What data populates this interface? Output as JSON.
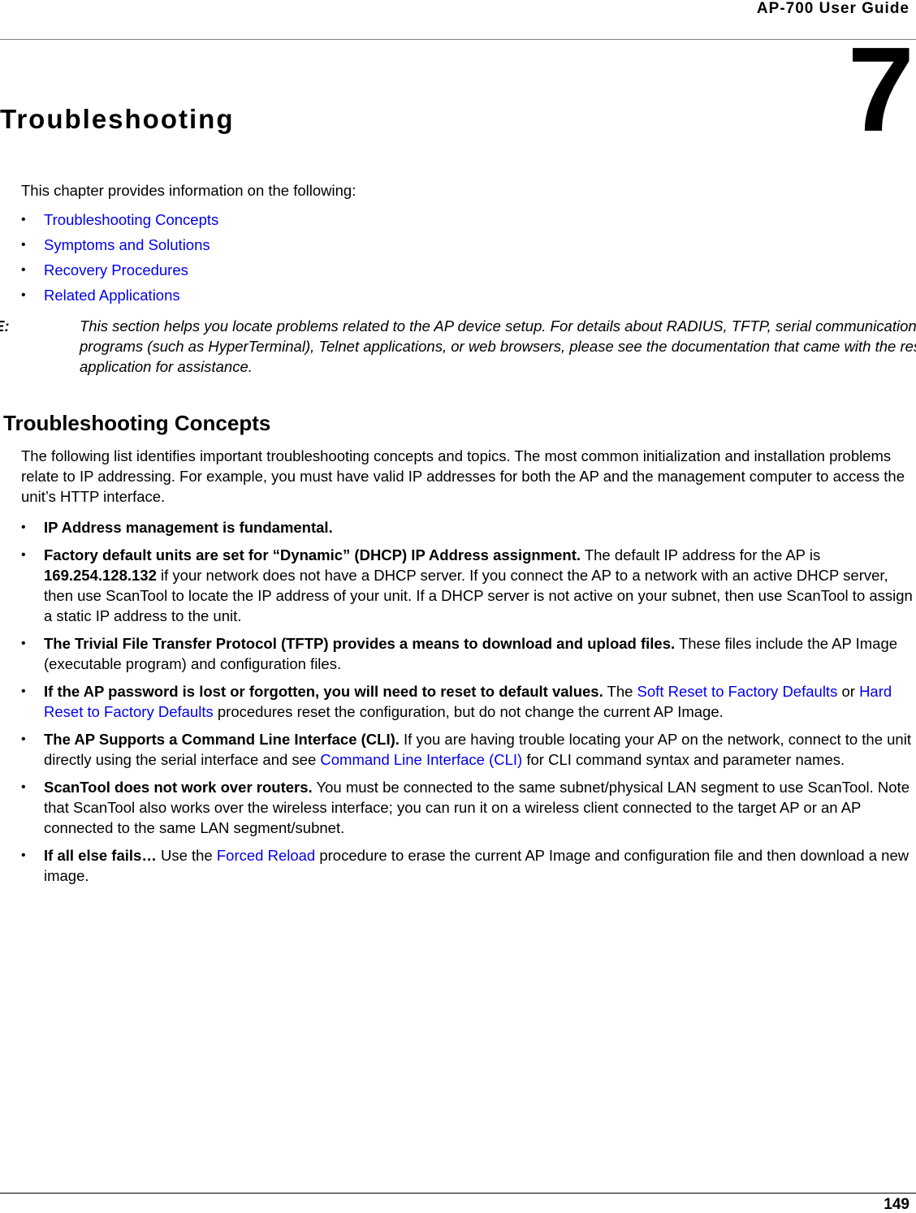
{
  "header": {
    "running_title": "AP-700 User Guide"
  },
  "chapter": {
    "number": "7",
    "title": "Troubleshooting"
  },
  "intro": {
    "text": "This chapter provides information on the following:",
    "links": [
      {
        "label": "Troubleshooting Concepts"
      },
      {
        "label": "Symptoms and Solutions"
      },
      {
        "label": "Recovery Procedures"
      },
      {
        "label": "Related Applications"
      }
    ],
    "bullet": "•"
  },
  "note": {
    "label": "NOTE:",
    "text": "This section helps you locate problems related to the AP device setup. For details about RADIUS, TFTP, serial communication programs (such as HyperTerminal), Telnet applications, or web browsers, please see the documentation that came with the respective application for assistance."
  },
  "section": {
    "heading": "Troubleshooting Concepts",
    "intro": "The following list identifies important troubleshooting concepts and topics. The most common initialization and installation problems relate to IP addressing. For example, you must have valid IP addresses for both the AP and the management computer to access the unit’s HTTP interface.",
    "items": [
      {
        "bold": "IP Address management is fundamental."
      },
      {
        "bold": "Factory default units are set for “Dynamic” (DHCP) IP Address assignment.",
        "text1": " The default IP address for the AP is ",
        "bold2": "169.254.128.132",
        "text2": " if your network does not have a DHCP server. If you connect the AP to a network with an active DHCP server, then use ScanTool to locate the IP address of your unit. If a DHCP server is not active on your subnet, then use ScanTool to assign a static IP address to the unit."
      },
      {
        "bold": "The Trivial File Transfer Protocol (TFTP) provides a means to download and upload files.",
        "text1": " These files include the AP Image (executable program) and configuration files."
      },
      {
        "bold": "If the AP password is lost or forgotten, you will need to reset to default values.",
        "text1": " The ",
        "link1": "Soft Reset to Factory Defaults",
        "text2": " or ",
        "link2": "Hard Reset to Factory Defaults",
        "text3": " procedures reset the configuration, but do not change the current AP Image."
      },
      {
        "bold": "The AP Supports a Command Line Interface (CLI).",
        "text1": " If you are having trouble locating your AP on the network, connect to the unit directly using the serial interface and see ",
        "link1": "Command Line Interface (CLI)",
        "text2": " for CLI command syntax and parameter names."
      },
      {
        "bold": "ScanTool does not work over routers.",
        "text1": " You must be connected to the same subnet/physical LAN segment to use ScanTool. Note that ScanTool also works over the wireless interface; you can run it on a wireless client connected to the target AP or an AP connected to the same LAN segment/subnet."
      },
      {
        "bold": "If all else fails…",
        "text1": " Use the ",
        "link1": "Forced Reload",
        "text2": " procedure to erase the current AP Image and configuration file and then download a new image."
      }
    ]
  },
  "footer": {
    "page_number": "149"
  },
  "colors": {
    "link": "#0000ee",
    "header_rule": "#808080",
    "text": "#000000"
  }
}
